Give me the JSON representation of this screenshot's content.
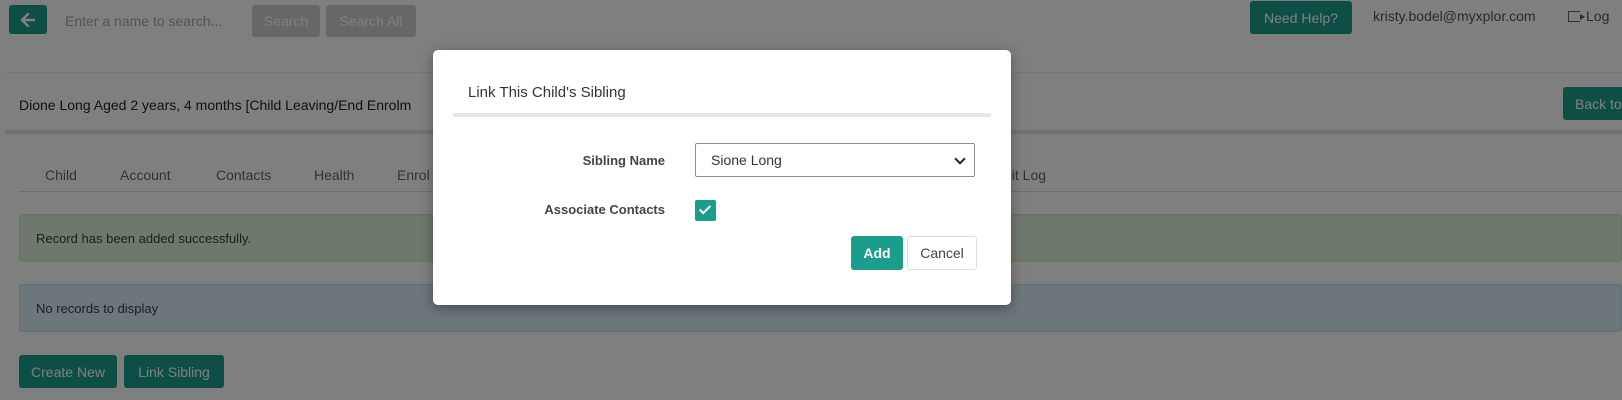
{
  "topbar": {
    "search_placeholder": "Enter a name to search...",
    "search_label": "Search",
    "search_all_label": "Search All",
    "help_label": "Need Help?",
    "user_email": "kristy.bodel@myxplor.com",
    "logout_label": "Log"
  },
  "child_header": {
    "title": "Dione Long Aged 2 years, 4 months [Child Leaving/End Enrolm",
    "back_label": "Back to"
  },
  "tabs": {
    "child": "Child",
    "account": "Account",
    "contacts": "Contacts",
    "health": "Health",
    "enrolment": "Enrol",
    "audit_log": "dit Log"
  },
  "alerts": {
    "success": "Record has been added successfully.",
    "info": "No records to display"
  },
  "actions": {
    "create_new": "Create New",
    "link_sibling": "Link Sibling"
  },
  "modal": {
    "title": "Link This Child's Sibling",
    "sibling_label": "Sibling Name",
    "sibling_value": "Sione Long",
    "associate_label": "Associate Contacts",
    "associate_checked": true,
    "add_label": "Add",
    "cancel_label": "Cancel"
  },
  "colors": {
    "accent": "#1a9d8a",
    "overlay": "rgba(0,0,0,0.5)"
  }
}
